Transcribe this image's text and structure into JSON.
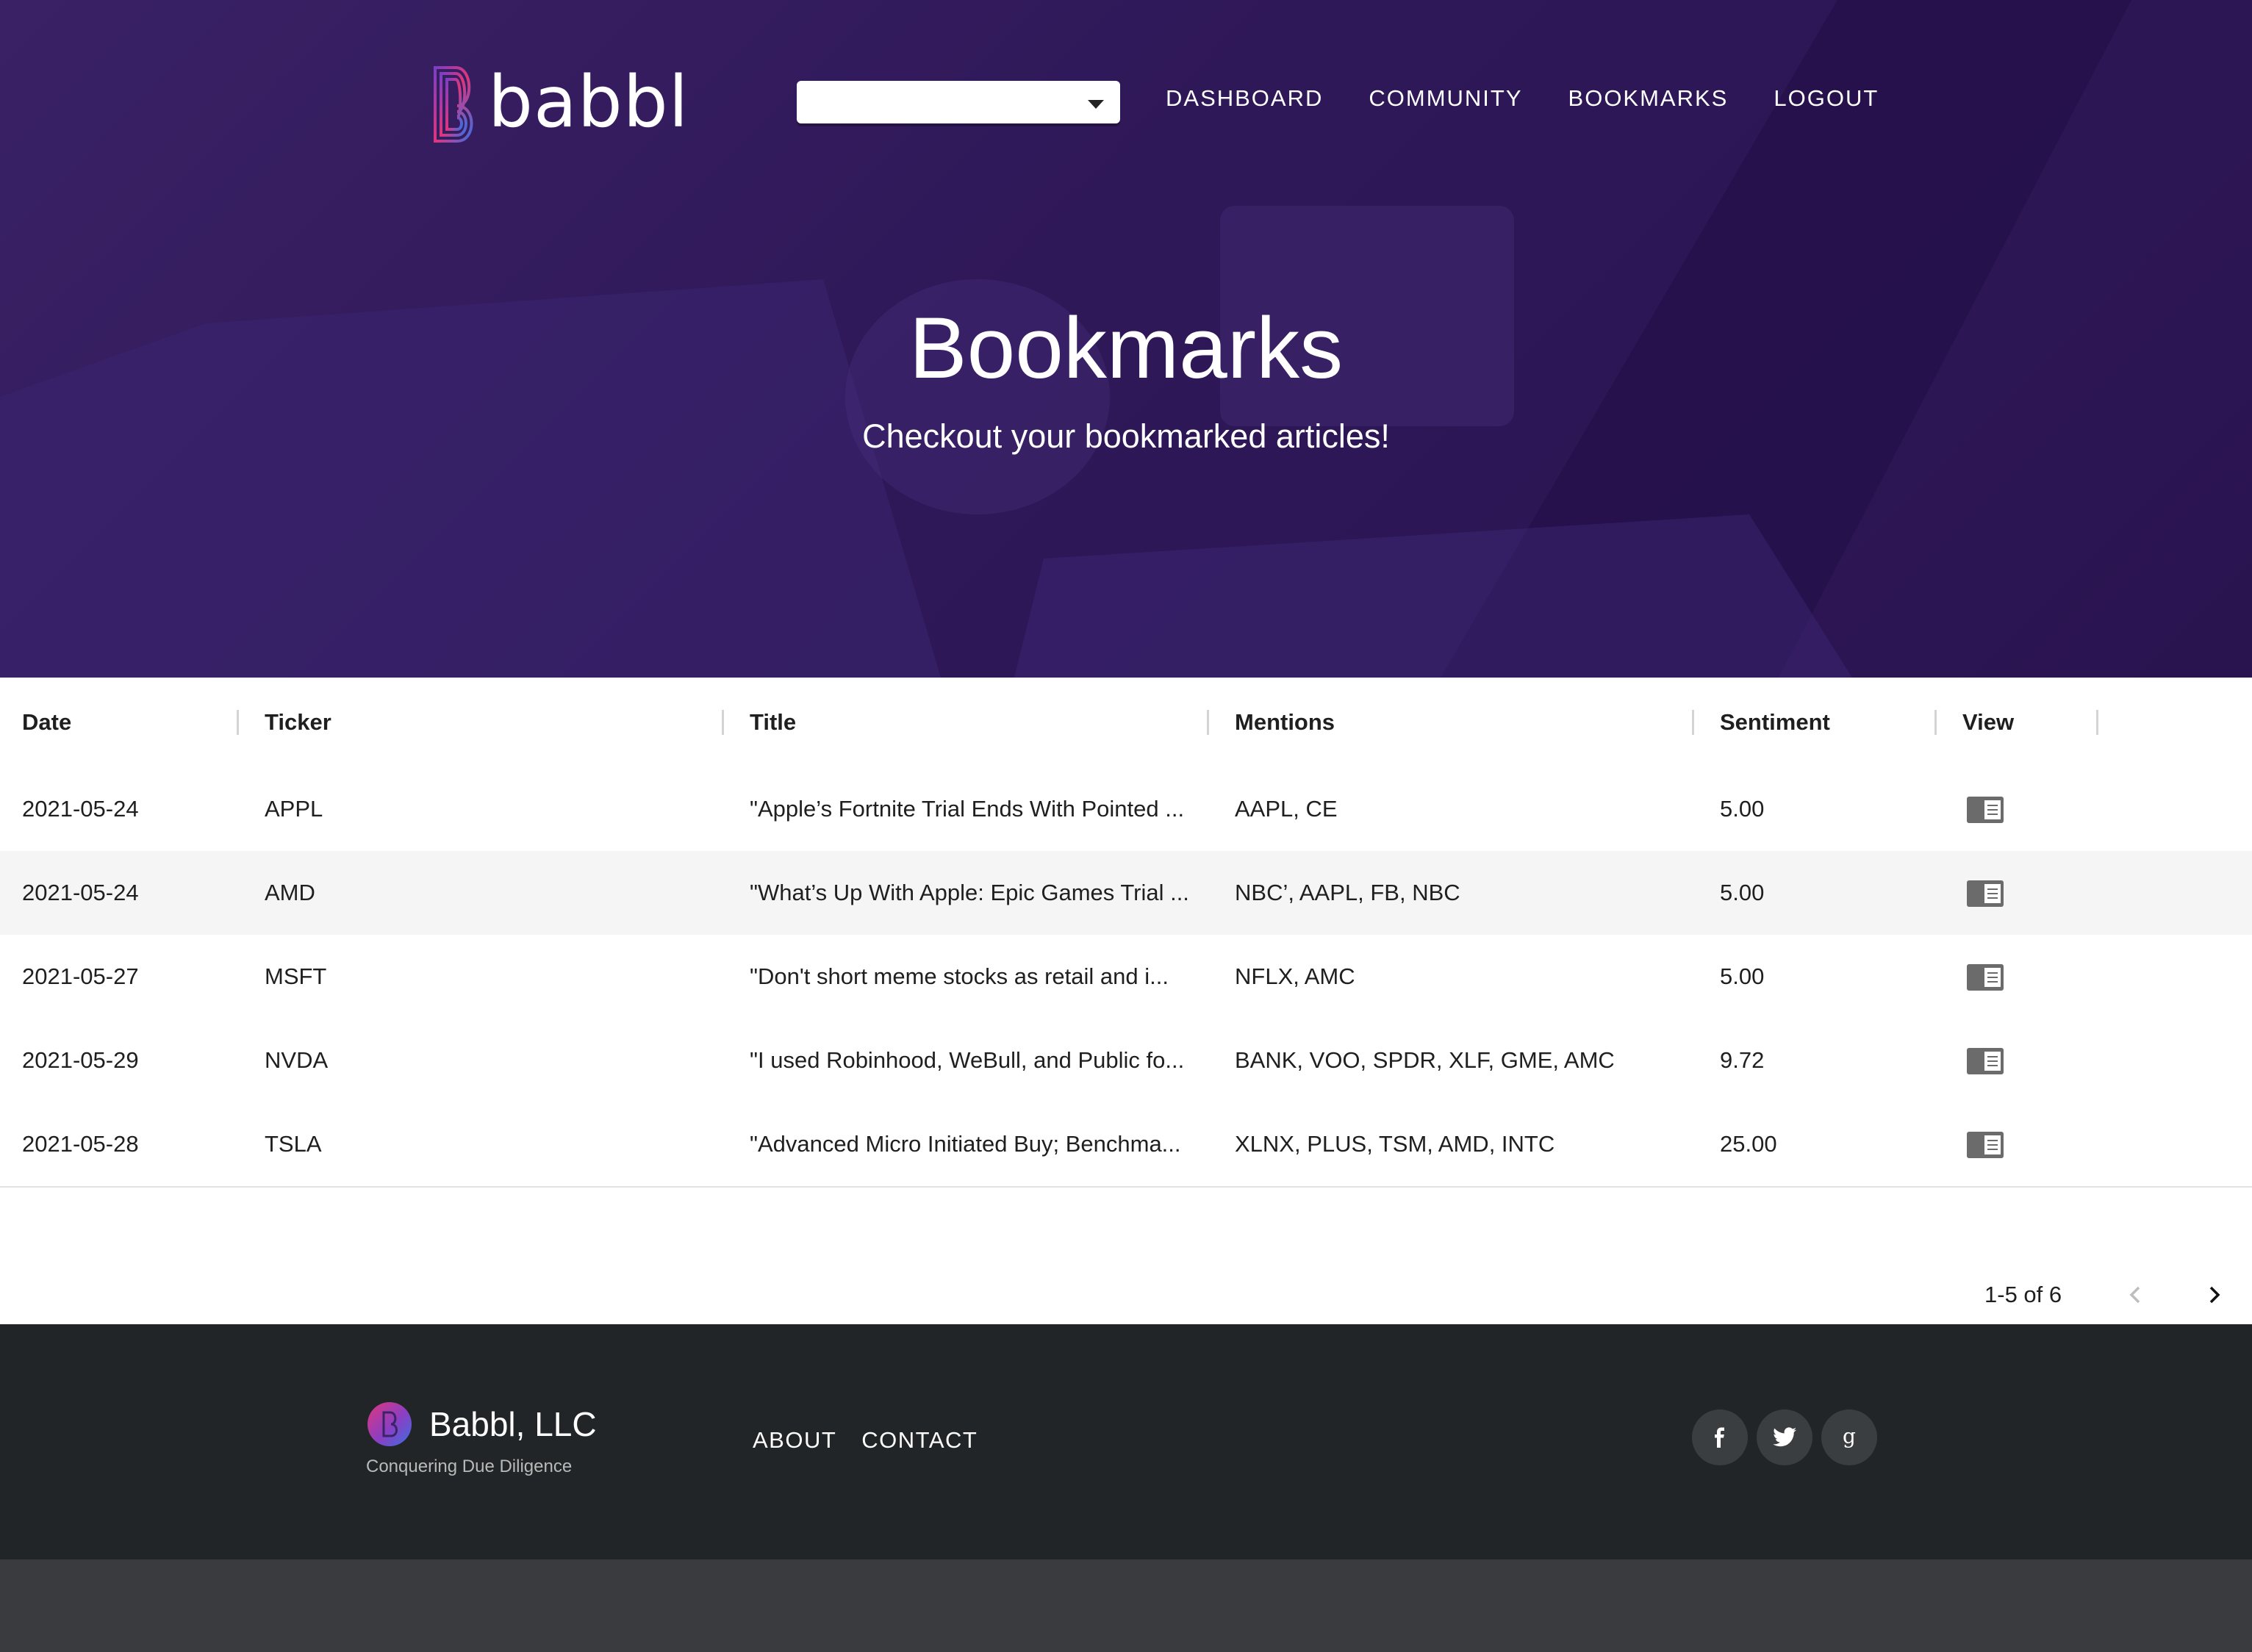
{
  "app": {
    "name": "babbl"
  },
  "nav": {
    "select_value": "",
    "items": [
      "DASHBOARD",
      "COMMUNITY",
      "BOOKMARKS",
      "LOGOUT"
    ]
  },
  "hero": {
    "title": "Bookmarks",
    "subtitle": "Checkout your bookmarked articles!"
  },
  "table": {
    "columns": [
      "Date",
      "Ticker",
      "Title",
      "Mentions",
      "Sentiment",
      "View"
    ],
    "rows": [
      {
        "date": "2021-05-24",
        "ticker": "APPL",
        "title": "\"Apple’s Fortnite Trial Ends With Pointed ...",
        "mentions": "AAPL, CE",
        "sentiment": "5.00",
        "view_icon": "article-icon"
      },
      {
        "date": "2021-05-24",
        "ticker": "AMD",
        "title": "\"What’s Up With Apple: Epic Games Trial ...",
        "mentions": "NBC’, AAPL, FB, NBC",
        "sentiment": "5.00",
        "view_icon": "article-icon"
      },
      {
        "date": "2021-05-27",
        "ticker": "MSFT",
        "title": "\"Don't short meme stocks as retail and i...",
        "mentions": "NFLX, AMC",
        "sentiment": "5.00",
        "view_icon": "article-icon"
      },
      {
        "date": "2021-05-29",
        "ticker": "NVDA",
        "title": "\"I used Robinhood, WeBull, and Public fo...",
        "mentions": "BANK, VOO, SPDR, XLF, GME, AMC",
        "sentiment": "9.72",
        "view_icon": "article-icon"
      },
      {
        "date": "2021-05-28",
        "ticker": "TSLA",
        "title": "\"Advanced Micro Initiated Buy; Benchma...",
        "mentions": "XLNX, PLUS, TSM, AMD, INTC",
        "sentiment": "25.00",
        "view_icon": "article-icon"
      }
    ],
    "pagination": {
      "label": "1-5 of 6"
    }
  },
  "footer": {
    "company": "Babbl, LLC",
    "tagline": "Conquering Due Diligence",
    "links": [
      "ABOUT",
      "CONTACT"
    ],
    "social": [
      "facebook-icon",
      "twitter-icon",
      "google-icon"
    ]
  },
  "colors": {
    "hero_bg": "#2f1858",
    "footer_bg": "#222527",
    "bottom_bg": "#3a3b3f",
    "logo_gradient": [
      "#7b3fc4",
      "#e0357c",
      "#3b6ee0"
    ]
  }
}
